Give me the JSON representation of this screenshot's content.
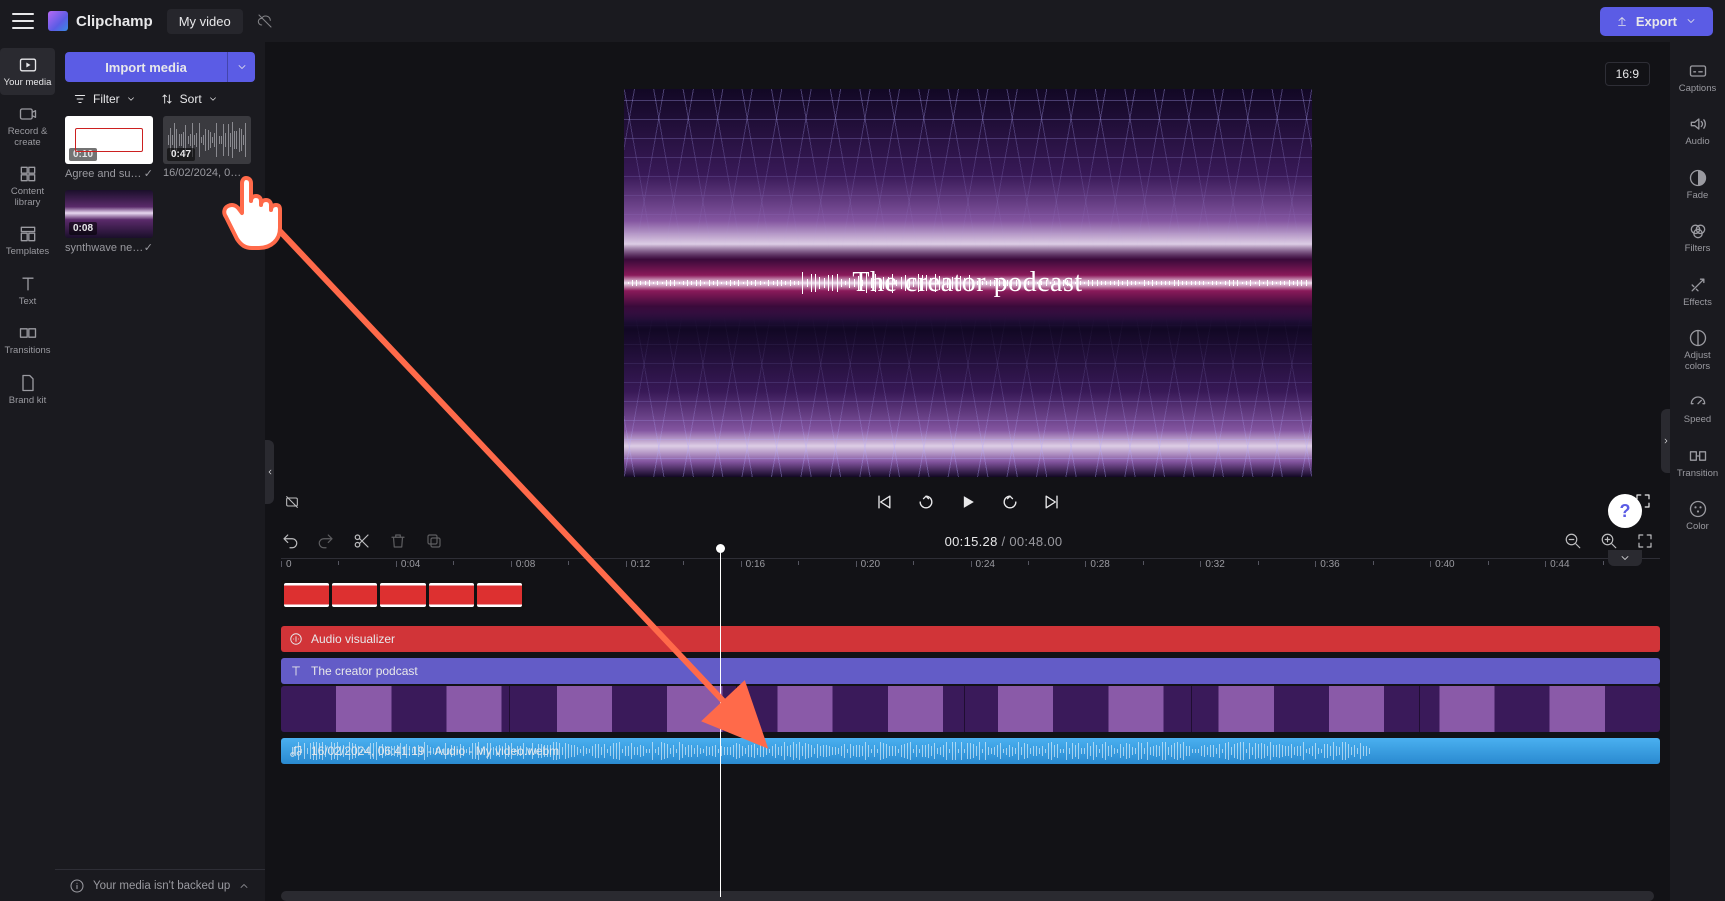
{
  "app": {
    "name": "Clipchamp",
    "project_title": "My video"
  },
  "export_btn": "Export",
  "aspect_ratio": "16:9",
  "leftrail": [
    {
      "id": "your-media",
      "label": "Your media"
    },
    {
      "id": "record",
      "label": "Record &\ncreate"
    },
    {
      "id": "library",
      "label": "Content\nlibrary"
    },
    {
      "id": "templates",
      "label": "Templates"
    },
    {
      "id": "text",
      "label": "Text"
    },
    {
      "id": "transitions",
      "label": "Transitions"
    },
    {
      "id": "brand",
      "label": "Brand kit"
    }
  ],
  "mediapanel": {
    "import_label": "Import media",
    "filter_label": "Filter",
    "sort_label": "Sort",
    "backup_msg": "Your media isn't backed up",
    "items": [
      {
        "id": "agree",
        "duration": "0:10",
        "name": "Agree and su…",
        "used": true,
        "kind": "agree"
      },
      {
        "id": "rec",
        "duration": "0:47",
        "name": "16/02/2024, 0…",
        "used": false,
        "kind": "audio"
      },
      {
        "id": "synth",
        "duration": "0:08",
        "name": "synthwave ne…",
        "used": true,
        "kind": "synth"
      }
    ]
  },
  "preview": {
    "title_text": "The creator podcast"
  },
  "playback": {
    "current": "00:15.28",
    "sep": " / ",
    "total": "00:48.00"
  },
  "ruler_ticks": [
    "0",
    "0:04",
    "0:08",
    "0:12",
    "0:16",
    "0:20",
    "0:24",
    "0:28",
    "0:32",
    "0:36",
    "0:40",
    "0:44"
  ],
  "tracks": {
    "visualizer_label": "Audio visualizer",
    "text_label": "The creator podcast",
    "audio_label": "16/02/2024, 06:41:19 - Audio - My video.webm"
  },
  "rightrail": [
    {
      "id": "captions",
      "label": "Captions"
    },
    {
      "id": "audio",
      "label": "Audio"
    },
    {
      "id": "fade",
      "label": "Fade"
    },
    {
      "id": "filters",
      "label": "Filters"
    },
    {
      "id": "effects",
      "label": "Effects"
    },
    {
      "id": "adjust",
      "label": "Adjust\ncolors"
    },
    {
      "id": "speed",
      "label": "Speed"
    },
    {
      "id": "transition",
      "label": "Transition"
    },
    {
      "id": "color",
      "label": "Color"
    }
  ],
  "colors": {
    "arrow": "#ff6a4a"
  }
}
